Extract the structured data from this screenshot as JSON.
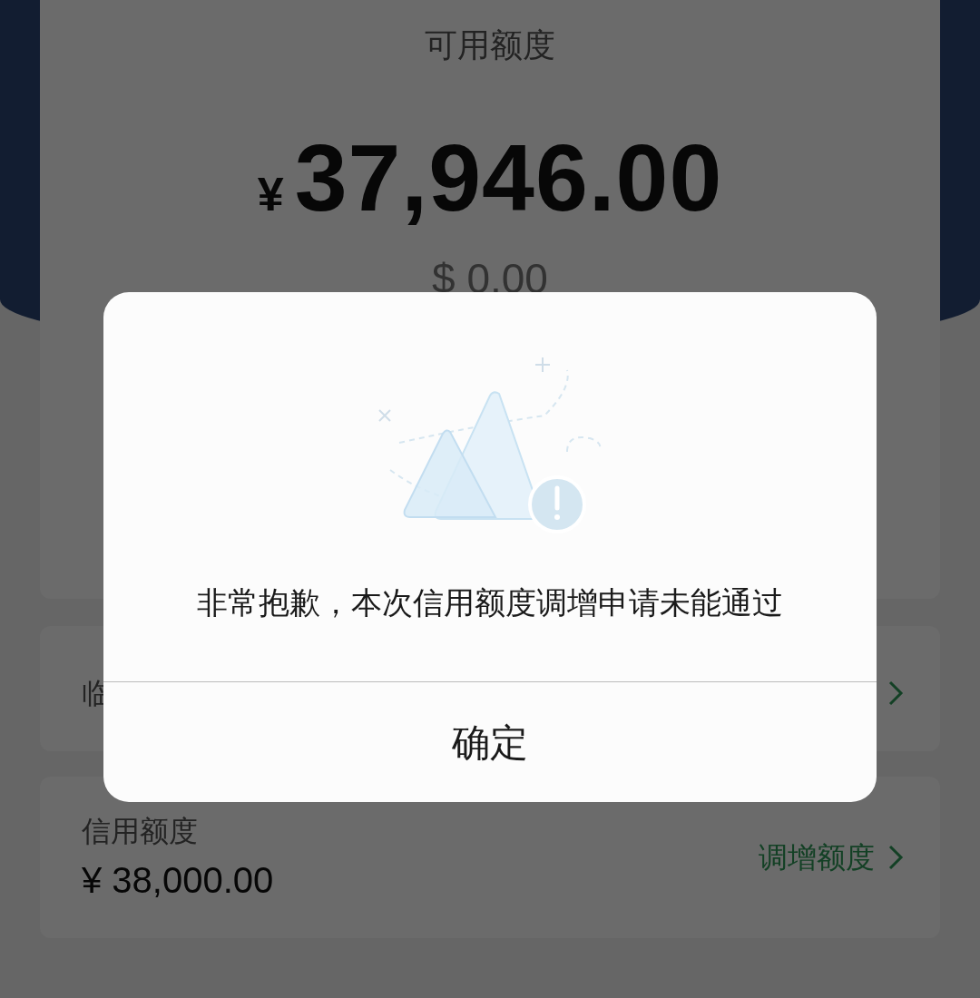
{
  "summary": {
    "title": "可用额度",
    "currency": "¥",
    "amount": "37,946.00",
    "usd_amount": "$ 0.00"
  },
  "temporary_limit": {
    "label": "临"
  },
  "credit_limit": {
    "label": "信用额度",
    "amount": "¥ 38,000.00",
    "action": "调增额度"
  },
  "dialog": {
    "message": "非常抱歉，本次信用额度调增申请未能通过",
    "button": "确定"
  }
}
